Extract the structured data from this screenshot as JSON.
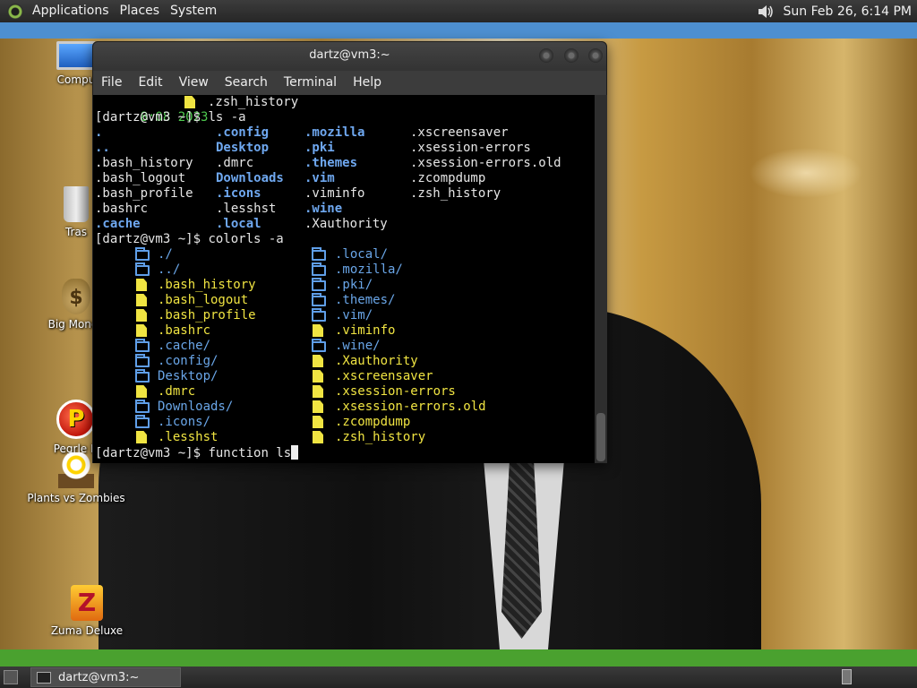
{
  "top_panel": {
    "menus": [
      "Applications",
      "Places",
      "System"
    ],
    "clock": "Sun Feb 26,  6:14 PM"
  },
  "desktop_icons": {
    "computer": "Compu",
    "trash": "Tras",
    "big_money": "Big Money",
    "peggle": "Pegrle D",
    "plants_vs_zombies": "Plants vs Zombies",
    "zuma": "Zuma Deluxe"
  },
  "terminal": {
    "title": "dartz@vm3:~",
    "menu": [
      "File",
      "Edit",
      "View",
      "Search",
      "Terminal",
      "Help"
    ],
    "first_line": {
      "date": "8:08 2023",
      "file": ".zsh_history"
    },
    "prompt": "[dartz@vm3 ~]$",
    "cmd1": "ls -a",
    "ls_columns": [
      [
        {
          "t": ".",
          "k": "dir"
        },
        {
          "t": "..",
          "k": "dir"
        },
        {
          "t": ".bash_history",
          "k": "plain"
        },
        {
          "t": ".bash_logout",
          "k": "plain"
        },
        {
          "t": ".bash_profile",
          "k": "plain"
        },
        {
          "t": ".bashrc",
          "k": "plain"
        },
        {
          "t": ".cache",
          "k": "dir"
        }
      ],
      [
        {
          "t": ".config",
          "k": "dir"
        },
        {
          "t": "Desktop",
          "k": "dir"
        },
        {
          "t": ".dmrc",
          "k": "plain"
        },
        {
          "t": "Downloads",
          "k": "dir"
        },
        {
          "t": ".icons",
          "k": "dir"
        },
        {
          "t": ".lesshst",
          "k": "plain"
        },
        {
          "t": ".local",
          "k": "dir"
        }
      ],
      [
        {
          "t": ".mozilla",
          "k": "dir"
        },
        {
          "t": ".pki",
          "k": "dir"
        },
        {
          "t": ".themes",
          "k": "dir"
        },
        {
          "t": ".vim",
          "k": "dir"
        },
        {
          "t": ".viminfo",
          "k": "plain"
        },
        {
          "t": ".wine",
          "k": "dir"
        },
        {
          "t": ".Xauthority",
          "k": "plain"
        }
      ],
      [
        {
          "t": ".xscreensaver",
          "k": "plain"
        },
        {
          "t": ".xsession-errors",
          "k": "plain"
        },
        {
          "t": ".xsession-errors.old",
          "k": "plain"
        },
        {
          "t": ".zcompdump",
          "k": "plain"
        },
        {
          "t": ".zsh_history",
          "k": "plain"
        }
      ]
    ],
    "cmd2": "colorls -a",
    "colorls_left": [
      {
        "t": "./",
        "k": "dir"
      },
      {
        "t": "../",
        "k": "dir"
      },
      {
        "t": ".bash_history",
        "k": "file"
      },
      {
        "t": ".bash_logout",
        "k": "file"
      },
      {
        "t": ".bash_profile",
        "k": "file"
      },
      {
        "t": ".bashrc",
        "k": "file"
      },
      {
        "t": ".cache/",
        "k": "dir"
      },
      {
        "t": ".config/",
        "k": "dir"
      },
      {
        "t": "Desktop/",
        "k": "dir"
      },
      {
        "t": ".dmrc",
        "k": "file"
      },
      {
        "t": "Downloads/",
        "k": "dir"
      },
      {
        "t": ".icons/",
        "k": "dir"
      },
      {
        "t": ".lesshst",
        "k": "file"
      }
    ],
    "colorls_right": [
      {
        "t": ".local/",
        "k": "dir"
      },
      {
        "t": ".mozilla/",
        "k": "dir"
      },
      {
        "t": ".pki/",
        "k": "dir"
      },
      {
        "t": ".themes/",
        "k": "dir"
      },
      {
        "t": ".vim/",
        "k": "dir"
      },
      {
        "t": ".viminfo",
        "k": "file"
      },
      {
        "t": ".wine/",
        "k": "dir"
      },
      {
        "t": ".Xauthority",
        "k": "file"
      },
      {
        "t": ".xscreensaver",
        "k": "file"
      },
      {
        "t": ".xsession-errors",
        "k": "file"
      },
      {
        "t": ".xsession-errors.old",
        "k": "file"
      },
      {
        "t": ".zcompdump",
        "k": "file"
      },
      {
        "t": ".zsh_history",
        "k": "file"
      }
    ],
    "cmd3": "function ls"
  },
  "taskbar": {
    "task_label": "dartz@vm3:~"
  },
  "colors": {
    "top_panel_strip": "#4d8fd0",
    "green_band": "#4aa12f",
    "dir_blue": "#6fa8f0",
    "file_yellow": "#f0e442",
    "date_green": "#4ec94e"
  }
}
